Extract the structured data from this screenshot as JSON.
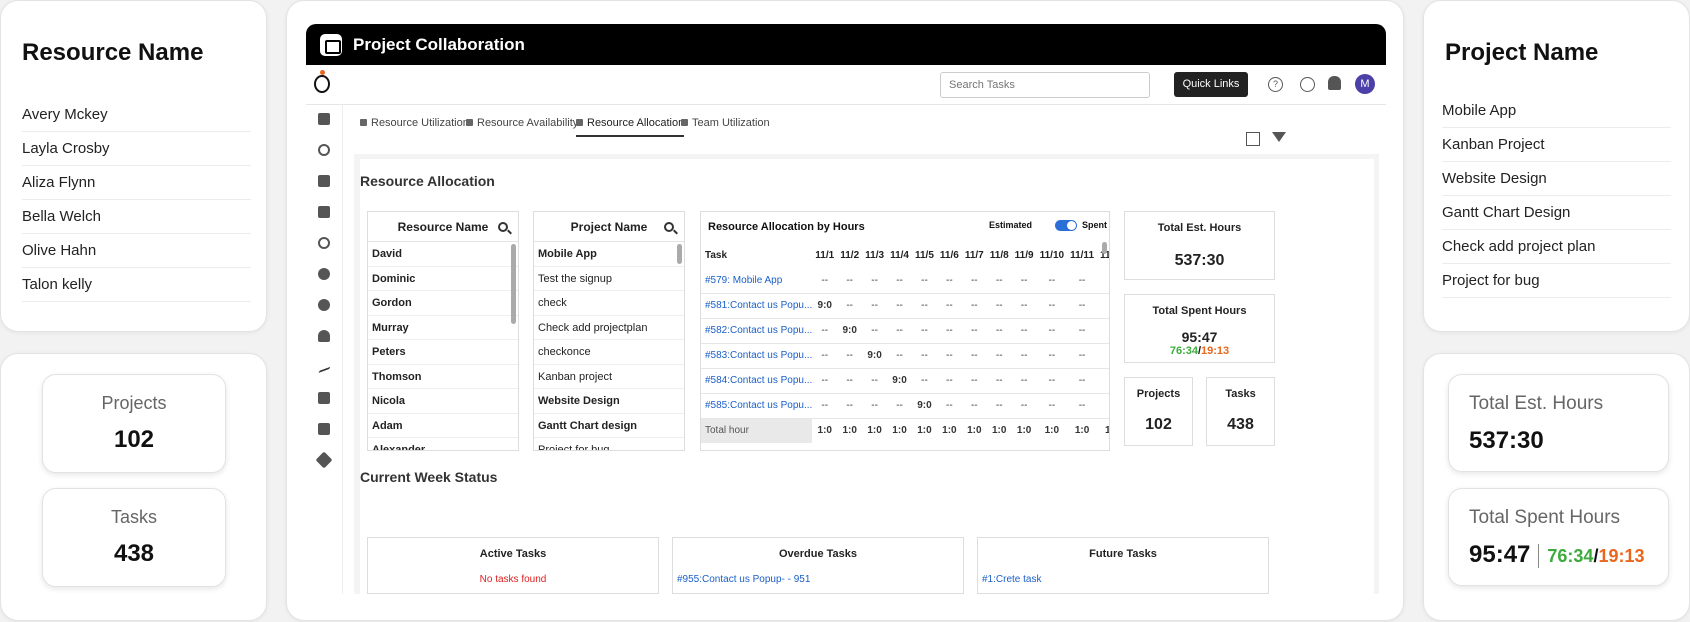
{
  "left_panel": {
    "title": "Resource Name",
    "resources": [
      "Avery Mckey",
      "Layla Crosby",
      "Aliza Flynn",
      "Bella Welch",
      "Olive Hahn",
      "Talon kelly"
    ],
    "projects_label": "Projects",
    "projects_value": "102",
    "tasks_label": "Tasks",
    "tasks_value": "438"
  },
  "right_panel": {
    "title": "Project Name",
    "projects": [
      "Mobile App",
      "Kanban Project",
      "Website Design",
      "Gantt Chart Design",
      "Check add project plan",
      "Project for bug"
    ],
    "est_label": "Total Est. Hours",
    "est_value": "537:30",
    "spent_label": "Total Spent Hours",
    "spent_value": "95:47",
    "spent_green": "76:34",
    "spent_slash": "/",
    "spent_orange": "19:13"
  },
  "app": {
    "title": "Project Collaboration",
    "search_placeholder": "Search Tasks",
    "quick_links": "Quick Links",
    "avatar": "M",
    "tabs": [
      "Resource Utilization",
      "Resource Availability",
      "Resource Allocation",
      "Team Utilization"
    ],
    "section_title": "Resource Allocation",
    "resource_header": "Resource Name",
    "resources": [
      "David",
      "Dominic",
      "Gordon",
      "Murray",
      "Peters",
      "Thomson",
      "Nicola",
      "Adam",
      "Alexander"
    ],
    "project_header": "Project Name",
    "projects": [
      "Mobile App",
      "Test the signup",
      "check",
      "Check add projectplan",
      "checkonce",
      "Kanban project",
      "Website Design",
      "Gantt Chart design",
      "Project for bug"
    ],
    "alloc_title": "Resource Allocation by Hours",
    "estimated": "Estimated",
    "spent": "Spent",
    "task_col": "Task",
    "dates": [
      "11/1",
      "11/2",
      "11/3",
      "11/4",
      "11/5",
      "11/6",
      "11/7",
      "11/8",
      "11/9",
      "11/10",
      "11/11",
      "11/12"
    ],
    "rows": [
      {
        "task": "#579: Mobile App",
        "cells": [
          "--",
          "--",
          "--",
          "--",
          "--",
          "--",
          "--",
          "--",
          "--",
          "--",
          "--",
          "--"
        ]
      },
      {
        "task": "#581:Contact us Popu...",
        "cells": [
          "9:0",
          "--",
          "--",
          "--",
          "--",
          "--",
          "--",
          "--",
          "--",
          "--",
          "--",
          "--"
        ]
      },
      {
        "task": "#582:Contact us Popu...",
        "cells": [
          "--",
          "9:0",
          "--",
          "--",
          "--",
          "--",
          "--",
          "--",
          "--",
          "--",
          "--",
          "--"
        ]
      },
      {
        "task": "#583:Contact us Popu...",
        "cells": [
          "--",
          "--",
          "9:0",
          "--",
          "--",
          "--",
          "--",
          "--",
          "--",
          "--",
          "--",
          "--"
        ]
      },
      {
        "task": "#584:Contact us Popu...",
        "cells": [
          "--",
          "--",
          "--",
          "9:0",
          "--",
          "--",
          "--",
          "--",
          "--",
          "--",
          "--",
          "--"
        ]
      },
      {
        "task": "#585:Contact us Popu...",
        "cells": [
          "--",
          "--",
          "--",
          "--",
          "9:0",
          "--",
          "--",
          "--",
          "--",
          "--",
          "--",
          "--"
        ]
      }
    ],
    "total_label": "Total hour",
    "totals": [
      "1:0",
      "1:0",
      "1:0",
      "1:0",
      "1:0",
      "1:0",
      "1:0",
      "1:0",
      "1:0",
      "1:0",
      "1:0",
      "1:0"
    ],
    "est_label": "Total Est. Hours",
    "est_value": "537:30",
    "spent_label": "Total Spent Hours",
    "spent_value": "95:47",
    "spent_green": "76:34",
    "spent_slash": "/",
    "spent_orange": "19:13",
    "projects_label": "Projects",
    "projects_value": "102",
    "tasks_label": "Tasks",
    "tasks_value": "438",
    "week_title": "Current Week Status",
    "active_title": "Active Tasks",
    "active_msg": "No tasks found",
    "overdue_title": "Overdue Tasks",
    "overdue_item": "#955:Contact us Popup- - 951",
    "future_title": "Future Tasks",
    "future_item": "#1:Crete task"
  },
  "colors": {
    "green": "#3cab3c",
    "orange": "#e8661d",
    "link": "#1a5fc8",
    "red": "#e02020"
  }
}
